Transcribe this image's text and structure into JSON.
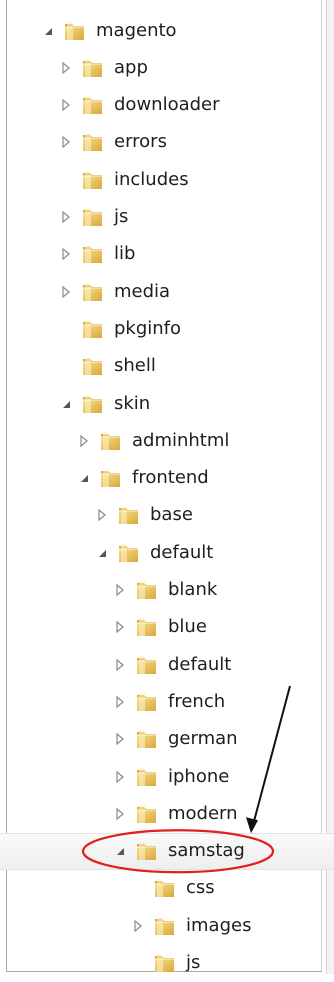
{
  "tree": [
    {
      "label": "magento",
      "depth": 0,
      "expander": "expanded"
    },
    {
      "label": "app",
      "depth": 1,
      "expander": "collapsed"
    },
    {
      "label": "downloader",
      "depth": 1,
      "expander": "collapsed"
    },
    {
      "label": "errors",
      "depth": 1,
      "expander": "collapsed"
    },
    {
      "label": "includes",
      "depth": 1,
      "expander": "none"
    },
    {
      "label": "js",
      "depth": 1,
      "expander": "collapsed"
    },
    {
      "label": "lib",
      "depth": 1,
      "expander": "collapsed"
    },
    {
      "label": "media",
      "depth": 1,
      "expander": "collapsed"
    },
    {
      "label": "pkginfo",
      "depth": 1,
      "expander": "none"
    },
    {
      "label": "shell",
      "depth": 1,
      "expander": "none"
    },
    {
      "label": "skin",
      "depth": 1,
      "expander": "expanded"
    },
    {
      "label": "adminhtml",
      "depth": 2,
      "expander": "collapsed"
    },
    {
      "label": "frontend",
      "depth": 2,
      "expander": "expanded"
    },
    {
      "label": "base",
      "depth": 3,
      "expander": "collapsed"
    },
    {
      "label": "default",
      "depth": 3,
      "expander": "expanded"
    },
    {
      "label": "blank",
      "depth": 4,
      "expander": "collapsed"
    },
    {
      "label": "blue",
      "depth": 4,
      "expander": "collapsed"
    },
    {
      "label": "default",
      "depth": 4,
      "expander": "collapsed"
    },
    {
      "label": "french",
      "depth": 4,
      "expander": "collapsed"
    },
    {
      "label": "german",
      "depth": 4,
      "expander": "collapsed"
    },
    {
      "label": "iphone",
      "depth": 4,
      "expander": "collapsed"
    },
    {
      "label": "modern",
      "depth": 4,
      "expander": "collapsed"
    },
    {
      "label": "samstag",
      "depth": 4,
      "expander": "expanded",
      "hovered": true,
      "annotated": true
    },
    {
      "label": "css",
      "depth": 5,
      "expander": "none"
    },
    {
      "label": "images",
      "depth": 5,
      "expander": "collapsed"
    },
    {
      "label": "js",
      "depth": 5,
      "expander": "none"
    }
  ],
  "colors": {
    "annotation": "#e0201b",
    "arrow": "#111111",
    "folder_light": "#f6dd8c",
    "folder_dark": "#d9a93a",
    "expander": "#555555"
  },
  "icons": {
    "folder": "folder-icon",
    "expanded": "triangle-down-icon",
    "collapsed": "triangle-right-icon"
  }
}
